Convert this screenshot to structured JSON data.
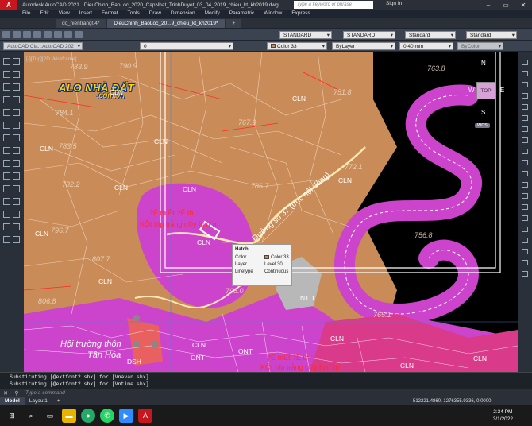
{
  "titlebar": {
    "app_name": "Autodesk AutoCAD 2021",
    "file_name": "DieuChinh_BaoLoc_2020_CapNhat_TrinhDuyet_03_04_2019_chieu_kt_kh2019.dwg",
    "search_placeholder": "Type a keyword or phrase",
    "sign_in": "Sign In"
  },
  "menu": [
    "File",
    "Edit",
    "View",
    "Insert",
    "Format",
    "Tools",
    "Draw",
    "Dimension",
    "Modify",
    "Parametric",
    "Window",
    "Express"
  ],
  "doc_tabs": [
    {
      "label": "dc_hientrang04*"
    },
    {
      "label": "DieuChinh_BaoLoc_20...9_chieu_kt_kh2019*"
    }
  ],
  "toolbar": {
    "layer_value": "0",
    "text_style": "STANDARD",
    "dim_style": "STANDARD",
    "table_style": "Standard",
    "mleader_style": "Standard",
    "color": "Color 33",
    "linetype": "ByLayer",
    "lineweight": "0.40 mm",
    "plot_style": "ByColor",
    "workspace": "AutoCAD Cla...AutoCAD 202"
  },
  "watermark": {
    "line1": "ALO NHÀ ĐẤT",
    ".com.vn": "",
    "line2": ".com.vn"
  },
  "viewport": {
    "label": "[-][Top][2D Wireframe]",
    "land_labels": [
      "CLN",
      "CLN",
      "CLN",
      "CLN",
      "CLN",
      "CLN",
      "CLN",
      "CLN",
      "CLN",
      "CLN",
      "CLN",
      "CLN",
      "CLN",
      "CLN",
      "ONT",
      "ONT",
      "DSH",
      "NTD"
    ],
    "numbers": [
      "790.9",
      "783.9",
      "784.1",
      "783.5",
      "767.9",
      "751.8",
      "763.8",
      "782.2",
      "786.7",
      "772.1",
      "796.7",
      "807.7",
      "756.8",
      "798.0",
      "806.8",
      "765.1"
    ],
    "red_texts": [
      "?Ê m Êt ?Ê th",
      "KÔt hîp trång c©y lu n¨m",
      "?Ê mÊt ?Ê th",
      "KÔt hîp trång c©y lu n¨m"
    ],
    "road_label": "Đường số 37 (trục nội đồng)",
    "village_label_1": "Hội trường thôn",
    "village_label_2": "Tân Hóa"
  },
  "tooltip": {
    "title": "Hatch",
    "rows": [
      {
        "k": "Color",
        "v": "Color 33"
      },
      {
        "k": "Layer",
        "v": "Level 30"
      },
      {
        "k": "Linetype",
        "v": "Continuous"
      }
    ]
  },
  "viewcube": {
    "n": "N",
    "s": "S",
    "e": "E",
    "w": "W",
    "face": "TOP",
    "wcs": "WCS"
  },
  "command": {
    "history": [
      "Substituting [@extfont2.shx] for [Vnavan.shx].",
      "Substituting [@extfont2.shx] for [Vntime.shx]."
    ],
    "placeholder": "Type a command"
  },
  "status": {
    "tabs": [
      "Model",
      "Layout1",
      "+"
    ],
    "coords": "512221.4860, 1276355.9336, 0.0000"
  },
  "taskbar": {
    "time": "2:34 PM",
    "date": "3/1/2022"
  }
}
